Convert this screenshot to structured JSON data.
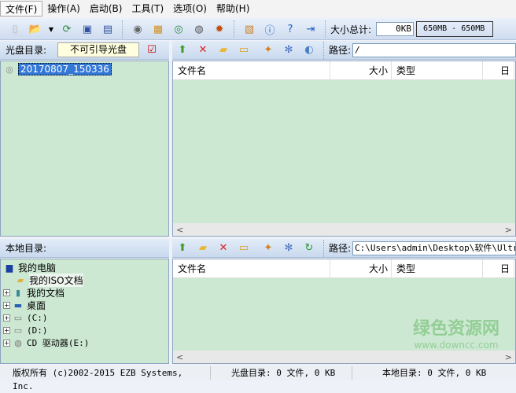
{
  "menu": [
    "文件(F)",
    "操作(A)",
    "启动(B)",
    "工具(T)",
    "选项(O)",
    "帮助(H)"
  ],
  "toolbar": {
    "size_label": "大小总计:",
    "size_value": "0KB",
    "capacity": "650MB - 650MB"
  },
  "iso_panel": {
    "label": "光盘目录:",
    "boot_status": "不可引导光盘",
    "path_label": "路径:",
    "path": "/",
    "root_item": "20170807_150336"
  },
  "local_panel": {
    "label": "本地目录:",
    "path_label": "路径:",
    "path": "C:\\Users\\admin\\Desktop\\软件\\UltraISO\\Ul-",
    "tree": [
      {
        "label": "我的电脑",
        "icon": "computer-icon"
      },
      {
        "label": "我的ISO文档",
        "icon": "folder-icon"
      },
      {
        "label": "我的文档",
        "icon": "documents-icon"
      },
      {
        "label": "桌面",
        "icon": "desktop-icon"
      },
      {
        "label": "(C:)",
        "icon": "drive-icon"
      },
      {
        "label": "(D:)",
        "icon": "drive-icon"
      },
      {
        "label": "CD 驱动器(E:)",
        "icon": "cd-drive-icon"
      }
    ]
  },
  "columns": [
    "文件名",
    "大小",
    "类型",
    "日"
  ],
  "status": {
    "copyright": "版权所有 (c)2002-2015 EZB Systems, Inc.",
    "iso_summary": "光盘目录: 0 文件, 0 KB",
    "local_summary": "本地目录: 0 文件, 0 KB"
  },
  "watermark": {
    "title": "绿色资源网",
    "url": "www.downcc.com"
  }
}
